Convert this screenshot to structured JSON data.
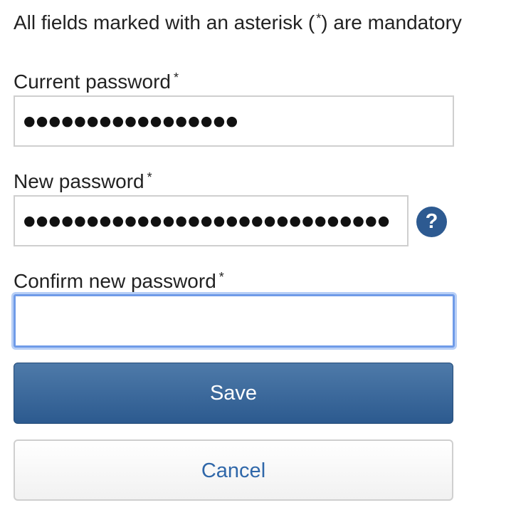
{
  "notice": {
    "text_before": "All fields marked with an asterisk (",
    "asterisk": "*",
    "text_after": ") are mandatory"
  },
  "form": {
    "current_password": {
      "label": "Current password",
      "required_mark": "*",
      "masked_value": "●●●●●●●●●●●●●●●●●"
    },
    "new_password": {
      "label": "New password",
      "required_mark": "*",
      "masked_value": "●●●●●●●●●●●●●●●●●●●●●●●●●●●●●",
      "help_icon": "?"
    },
    "confirm_password": {
      "label": "Confirm new password",
      "required_mark": "*",
      "value": ""
    }
  },
  "buttons": {
    "save_label": "Save",
    "cancel_label": "Cancel"
  },
  "colors": {
    "primary": "#2c5a8f",
    "link": "#2f67a9",
    "focus": "#6f9be8"
  }
}
